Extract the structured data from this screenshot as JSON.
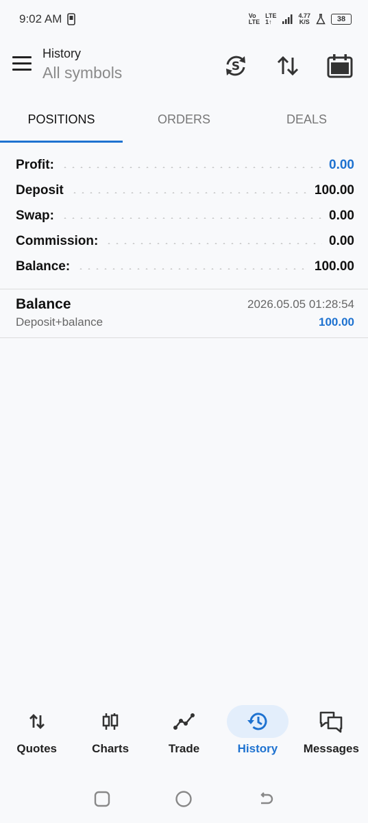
{
  "status_bar": {
    "time": "9:02 AM",
    "net_speed_value": "4.77",
    "net_speed_unit": "K/S",
    "volte_top": "Vo",
    "volte_bottom": "LTE",
    "lte_top": "LTE",
    "lte_bottom": "1↑",
    "battery": "38"
  },
  "header": {
    "title": "History",
    "subtitle": "All symbols"
  },
  "tabs": [
    {
      "label": "POSITIONS",
      "active": true
    },
    {
      "label": "ORDERS",
      "active": false
    },
    {
      "label": "DEALS",
      "active": false
    }
  ],
  "summary": {
    "profit_label": "Profit:",
    "profit_value": "0.00",
    "deposit_label": "Deposit",
    "deposit_value": "100.00",
    "swap_label": "Swap:",
    "swap_value": "0.00",
    "commission_label": "Commission:",
    "commission_value": "0.00",
    "balance_label": "Balance:",
    "balance_value": "100.00"
  },
  "deal": {
    "title": "Balance",
    "time": "2026.05.05 01:28:54",
    "description": "Deposit+balance",
    "amount": "100.00"
  },
  "bottom_nav": [
    {
      "label": "Quotes",
      "icon": "quotes-icon",
      "active": false
    },
    {
      "label": "Charts",
      "icon": "candles-icon",
      "active": false
    },
    {
      "label": "Trade",
      "icon": "trade-line-icon",
      "active": false
    },
    {
      "label": "History",
      "icon": "history-icon",
      "active": true
    },
    {
      "label": "Messages",
      "icon": "messages-icon",
      "active": false
    }
  ],
  "colors": {
    "accent": "#1e72d0",
    "active_nav_bg": "#e3eefb",
    "background": "#f8f9fb"
  }
}
